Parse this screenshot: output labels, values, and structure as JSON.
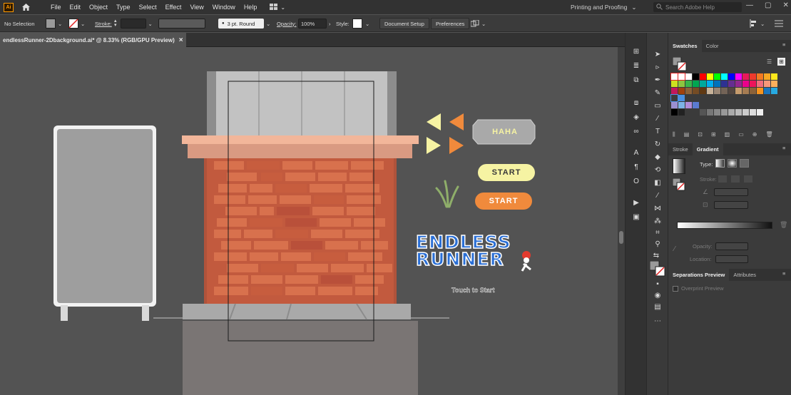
{
  "app": {
    "logo_text": "Ai"
  },
  "menubar": {
    "menus": [
      "File",
      "Edit",
      "Object",
      "Type",
      "Select",
      "Effect",
      "View",
      "Window",
      "Help"
    ],
    "workspace": "Printing and Proofing",
    "search_placeholder": "Search Adobe Help"
  },
  "controlbar": {
    "selection": "No Selection",
    "stroke_label": "Stroke:",
    "brush": "3 pt. Round",
    "opacity_label": "Opacity:",
    "opacity_value": "100%",
    "style_label": "Style:",
    "document_setup": "Document Setup",
    "preferences": "Preferences"
  },
  "document": {
    "tab_title": "endlessRunner-2Dbackground.ai* @ 8.33% (RGB/GPU Preview)",
    "close": "×"
  },
  "artwork": {
    "haha_label": "HAHA",
    "start_label_1": "START",
    "start_label_2": "START",
    "logo_line1": "ENDLESS",
    "logo_line2": "RUNNER",
    "touch_label": "Touch to Start"
  },
  "panels": {
    "swatches_tab": "Swatches",
    "color_tab": "Color",
    "stroke_tab": "Stroke",
    "gradient_tab": "Gradient",
    "type_label": "Type:",
    "stroke_label": "Stroke:",
    "opacity_label": "Opacity:",
    "location_label": "Location:",
    "separations_tab": "Separations Preview",
    "attributes_tab": "Attributes",
    "overprint_label": "Overprint Preview"
  },
  "colors": {
    "accent": "#ff9a00",
    "brick": "#c8623e",
    "start_yellow": "#f6f3a3",
    "start_orange": "#f08a3c",
    "logo_blue": "#2a6fd6"
  }
}
